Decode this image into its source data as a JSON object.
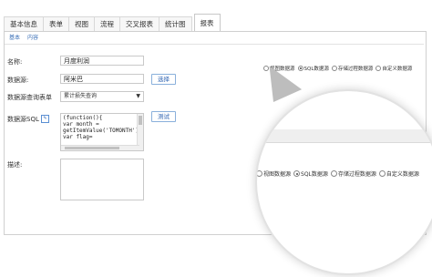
{
  "tabs": [
    "基本信息",
    "表单",
    "视图",
    "流程",
    "交叉报表",
    "统计图",
    "报表"
  ],
  "active_tab": "报表",
  "subtabs": [
    "基本",
    "内容"
  ],
  "form": {
    "name_label": "名称:",
    "name_value": "月度利润",
    "datasource_label": "数据源:",
    "datasource_value": "阿米巴",
    "select_button": "选择",
    "query_form_label": "数据源查询表单",
    "query_form_value": "累计损失查询",
    "sql_label": "数据源SQL",
    "sql_icon": "edit-icon",
    "test_button": "测试",
    "sql_lines": [
      "(function(){",
      " var month =",
      "getItemValue('TOMONTH');",
      "var flag="
    ],
    "desc_label": "描述:"
  },
  "source_types": {
    "options": [
      "视图数据源",
      "SQL数据源",
      "存储过程数据源",
      "自定义数据源"
    ],
    "selected": "SQL数据源"
  },
  "colors": {
    "accent": "#2f64b2",
    "border": "#c9c9c9"
  }
}
